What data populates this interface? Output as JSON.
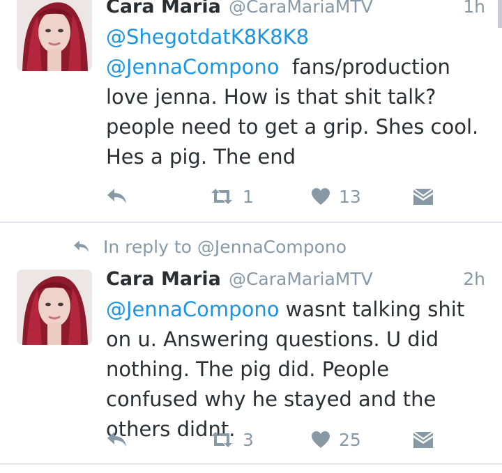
{
  "tweets": [
    {
      "name": "Cara Maria",
      "handle": "@CaraMariaMTV",
      "time": "1h",
      "text_parts": [
        {
          "mention": "@ShegotdatK8K8K8"
        },
        {
          "mention": "@JennaCompono"
        },
        {
          "plain": "fans/production love jenna. How is that shit talk?people need to get a grip. Shes cool. Hes a pig. The end"
        }
      ],
      "retweets": "1",
      "likes": "13"
    },
    {
      "reply_context": "In reply to @JennaCompono",
      "name": "Cara Maria",
      "handle": "@CaraMariaMTV",
      "time": "2h",
      "text_parts": [
        {
          "mention": "@JennaCompono"
        },
        {
          "plain": "wasnt talking shit on u. Answering questions. U did nothing. The pig did. People confused why he stayed and the others didnt."
        }
      ],
      "retweets": "3",
      "likes": "25"
    }
  ],
  "icons": {
    "reply": "reply-arrow-icon",
    "retweet": "retweet-icon",
    "like": "heart-icon",
    "dm": "envelope-icon",
    "avatar": "profile-photo"
  },
  "colors": {
    "link": "#1b95e0",
    "muted": "#8899a6",
    "text": "#292f33",
    "divider": "#e1e8ed"
  }
}
